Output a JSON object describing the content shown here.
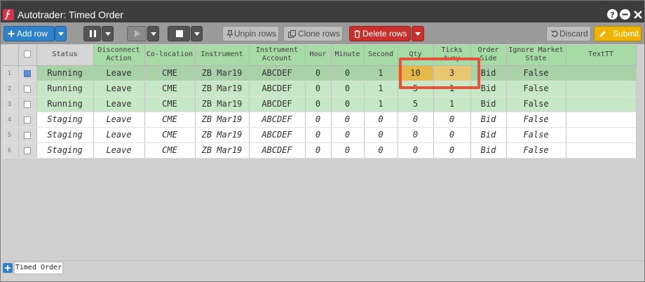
{
  "window": {
    "title": "Autotrader: Timed Order"
  },
  "toolbar": {
    "add_row": "Add row",
    "unpin_rows": "Unpin rows",
    "clone_rows": "Clone rows",
    "delete_rows": "Delete rows",
    "discard": "Discard",
    "submit": "Submit"
  },
  "table": {
    "columns": [
      "Status",
      "Disconnect Action",
      "Co-location",
      "Instrument",
      "Instrument Account",
      "Hour",
      "Minute",
      "Second",
      "Qty",
      "Ticks Away",
      "Order Side",
      "Ignore Market State",
      "TextTT"
    ],
    "rows": [
      {
        "num": "1",
        "status": "Running",
        "disconnect": "Leave",
        "coloc": "CME",
        "instrument": "ZB Mar19",
        "account": "ABCDEF",
        "hour": "0",
        "minute": "0",
        "second": "1",
        "qty": "10",
        "ticks": "3",
        "side": "Bid",
        "ignore": "False",
        "text": ""
      },
      {
        "num": "2",
        "status": "Running",
        "disconnect": "Leave",
        "coloc": "CME",
        "instrument": "ZB Mar19",
        "account": "ABCDEF",
        "hour": "0",
        "minute": "0",
        "second": "1",
        "qty": "5",
        "ticks": "1",
        "side": "Bid",
        "ignore": "False",
        "text": ""
      },
      {
        "num": "3",
        "status": "Running",
        "disconnect": "Leave",
        "coloc": "CME",
        "instrument": "ZB Mar19",
        "account": "ABCDEF",
        "hour": "0",
        "minute": "0",
        "second": "1",
        "qty": "5",
        "ticks": "1",
        "side": "Bid",
        "ignore": "False",
        "text": ""
      },
      {
        "num": "4",
        "status": "Staging",
        "disconnect": "Leave",
        "coloc": "CME",
        "instrument": "ZB Mar19",
        "account": "ABCDEF",
        "hour": "0",
        "minute": "0",
        "second": "0",
        "qty": "0",
        "ticks": "0",
        "side": "Bid",
        "ignore": "False",
        "text": ""
      },
      {
        "num": "5",
        "status": "Staging",
        "disconnect": "Leave",
        "coloc": "CME",
        "instrument": "ZB Mar19",
        "account": "ABCDEF",
        "hour": "0",
        "minute": "0",
        "second": "0",
        "qty": "0",
        "ticks": "0",
        "side": "Bid",
        "ignore": "False",
        "text": ""
      },
      {
        "num": "6",
        "status": "Staging",
        "disconnect": "Leave",
        "coloc": "CME",
        "instrument": "ZB Mar19",
        "account": "ABCDEF",
        "hour": "0",
        "minute": "0",
        "second": "0",
        "qty": "0",
        "ticks": "0",
        "side": "Bid",
        "ignore": "False",
        "text": ""
      }
    ]
  },
  "tabs": {
    "active": "Timed Order"
  },
  "colors": {
    "accent_blue": "#2f82c8",
    "delete_red": "#c9302c",
    "submit_yellow": "#f0b400",
    "running_green": "#c6e8c6",
    "highlight_red": "#e8503a"
  },
  "icons": [
    "app-logo-icon",
    "help-icon",
    "minimize-icon",
    "close-icon",
    "plus-icon",
    "pause-icon",
    "play-icon",
    "stop-icon",
    "pin-icon",
    "clone-icon",
    "trash-icon",
    "undo-icon",
    "pencil-icon",
    "chevron-down-icon"
  ]
}
